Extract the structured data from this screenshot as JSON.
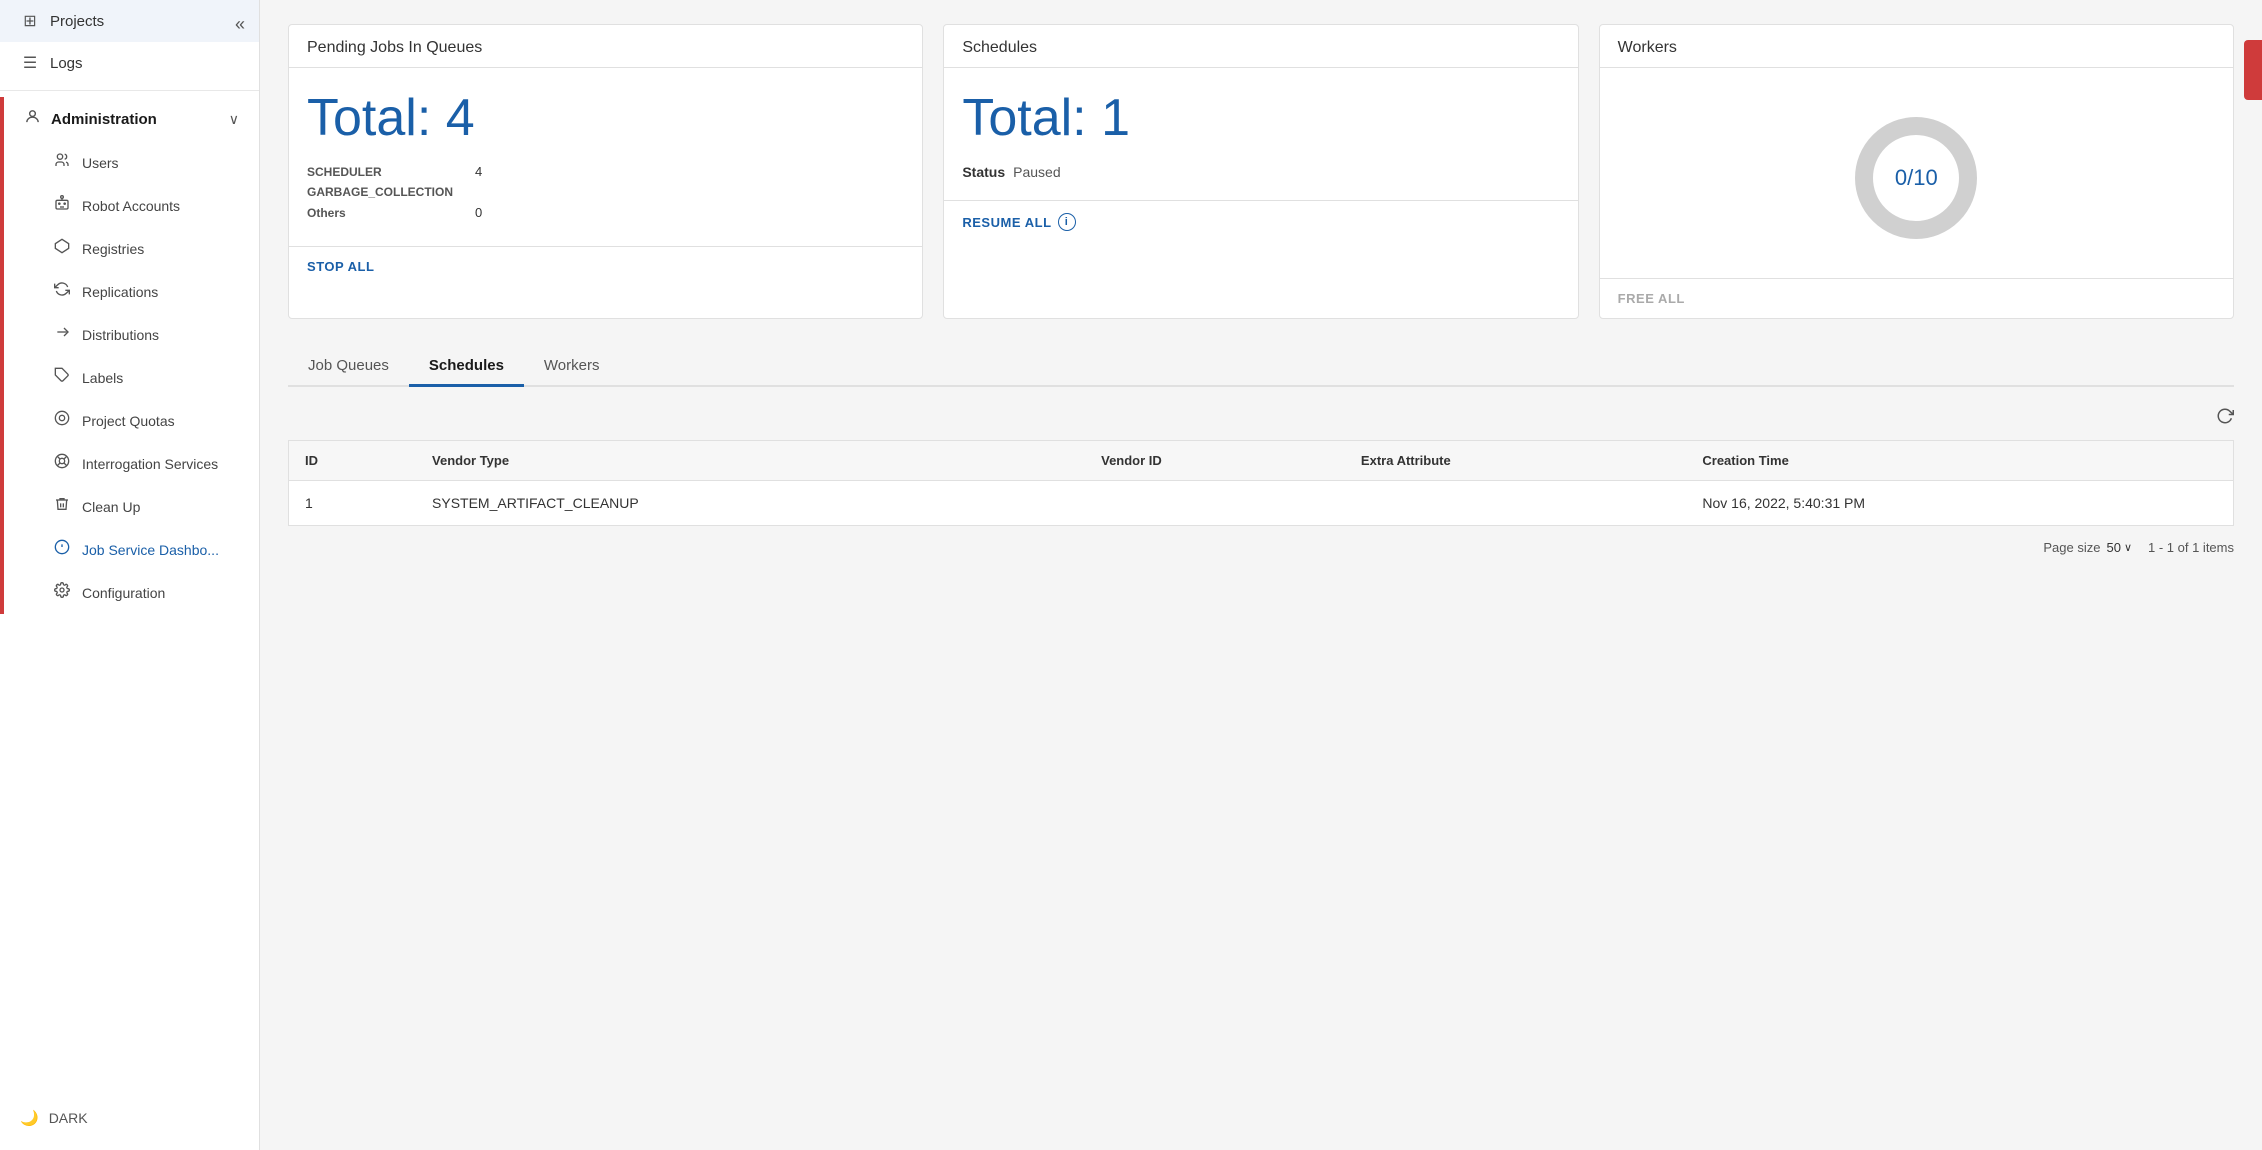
{
  "sidebar": {
    "collapse_btn": "«",
    "items": [
      {
        "id": "projects",
        "label": "Projects",
        "icon": "⊞"
      },
      {
        "id": "logs",
        "label": "Logs",
        "icon": "≡"
      },
      {
        "id": "administration",
        "label": "Administration",
        "icon": "👤",
        "expanded": true
      },
      {
        "id": "users",
        "label": "Users",
        "icon": "👥"
      },
      {
        "id": "robot-accounts",
        "label": "Robot Accounts",
        "icon": "🤖"
      },
      {
        "id": "registries",
        "label": "Registries",
        "icon": "⬡"
      },
      {
        "id": "replications",
        "label": "Replications",
        "icon": "⟳"
      },
      {
        "id": "distributions",
        "label": "Distributions",
        "icon": "✂"
      },
      {
        "id": "labels",
        "label": "Labels",
        "icon": "🏷"
      },
      {
        "id": "project-quotas",
        "label": "Project Quotas",
        "icon": "◎"
      },
      {
        "id": "interrogation-services",
        "label": "Interrogation Services",
        "icon": "⊙"
      },
      {
        "id": "clean-up",
        "label": "Clean Up",
        "icon": "🗑"
      },
      {
        "id": "job-service-dashboard",
        "label": "Job Service Dashbo...",
        "icon": "⊕"
      },
      {
        "id": "configuration",
        "label": "Configuration",
        "icon": "⚙"
      }
    ],
    "dark_mode_label": "DARK"
  },
  "cards": {
    "pending_jobs": {
      "title": "Pending Jobs In Queues",
      "total_label": "Total: 4",
      "stats": [
        {
          "label": "SCHEDULER",
          "value": "4"
        },
        {
          "label": "GARBAGE_COLLECTION",
          "value": ""
        },
        {
          "label": "Others",
          "value": "0"
        }
      ],
      "action": "STOP ALL"
    },
    "schedules": {
      "title": "Schedules",
      "total_label": "Total: 1",
      "status_label": "Status",
      "status_value": "Paused",
      "action": "RESUME ALL",
      "info_icon": "ℹ"
    },
    "workers": {
      "title": "Workers",
      "donut_label": "0/10",
      "donut_used": 0,
      "donut_total": 10,
      "action": "FREE ALL"
    }
  },
  "tabs": [
    {
      "id": "job-queues",
      "label": "Job Queues"
    },
    {
      "id": "schedules",
      "label": "Schedules",
      "active": true
    },
    {
      "id": "workers",
      "label": "Workers"
    }
  ],
  "table": {
    "columns": [
      {
        "id": "id",
        "label": "ID"
      },
      {
        "id": "vendor-type",
        "label": "Vendor Type"
      },
      {
        "id": "vendor-id",
        "label": "Vendor ID"
      },
      {
        "id": "extra-attribute",
        "label": "Extra Attribute"
      },
      {
        "id": "creation-time",
        "label": "Creation Time"
      }
    ],
    "rows": [
      {
        "id": "1",
        "vendor_type": "SYSTEM_ARTIFACT_CLEANUP",
        "vendor_id": "",
        "extra_attribute": "",
        "creation_time": "Nov 16, 2022, 5:40:31 PM"
      }
    ]
  },
  "pagination": {
    "page_size_label": "Page size",
    "page_size_value": "50",
    "range_label": "1 - 1 of 1 items"
  }
}
